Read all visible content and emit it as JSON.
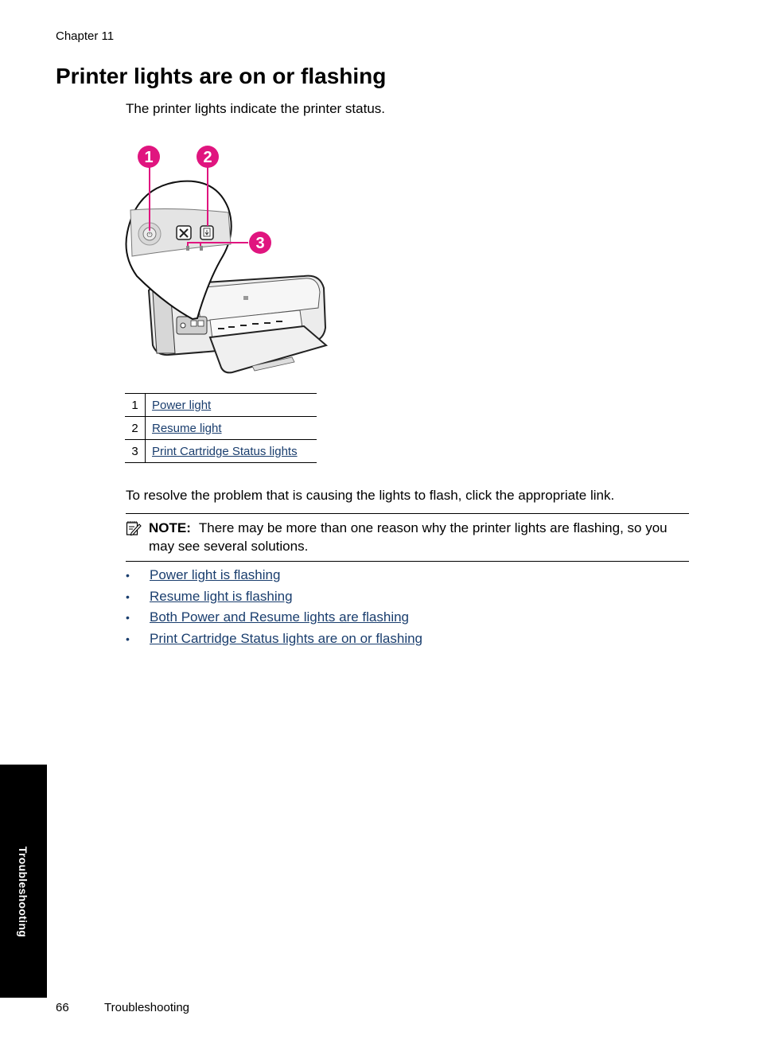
{
  "header": {
    "chapter": "Chapter 11"
  },
  "title": "Printer lights are on or flashing",
  "intro": "The printer lights indicate the printer status.",
  "figure": {
    "description": "HP printer with zoomed control panel callout",
    "callout_color": "#e0157f",
    "callouts": [
      "1",
      "2",
      "3"
    ]
  },
  "legend": [
    {
      "num": "1",
      "label": "Power light"
    },
    {
      "num": "2",
      "label": "Resume light"
    },
    {
      "num": "3",
      "label": "Print Cartridge Status lights"
    }
  ],
  "resolve_text": "To resolve the problem that is causing the lights to flash, click the appropriate link.",
  "note": {
    "label": "NOTE:",
    "text": "There may be more than one reason why the printer lights are flashing, so you may see several solutions."
  },
  "links": [
    "Power light is flashing",
    "Resume light is flashing",
    "Both Power and Resume lights are flashing",
    "Print Cartridge Status lights are on or flashing"
  ],
  "bullet": "•",
  "side_tab": "Troubleshooting",
  "footer": {
    "page": "66",
    "section": "Troubleshooting"
  },
  "colors": {
    "link": "#1a3e6e",
    "callout": "#e0157f"
  }
}
